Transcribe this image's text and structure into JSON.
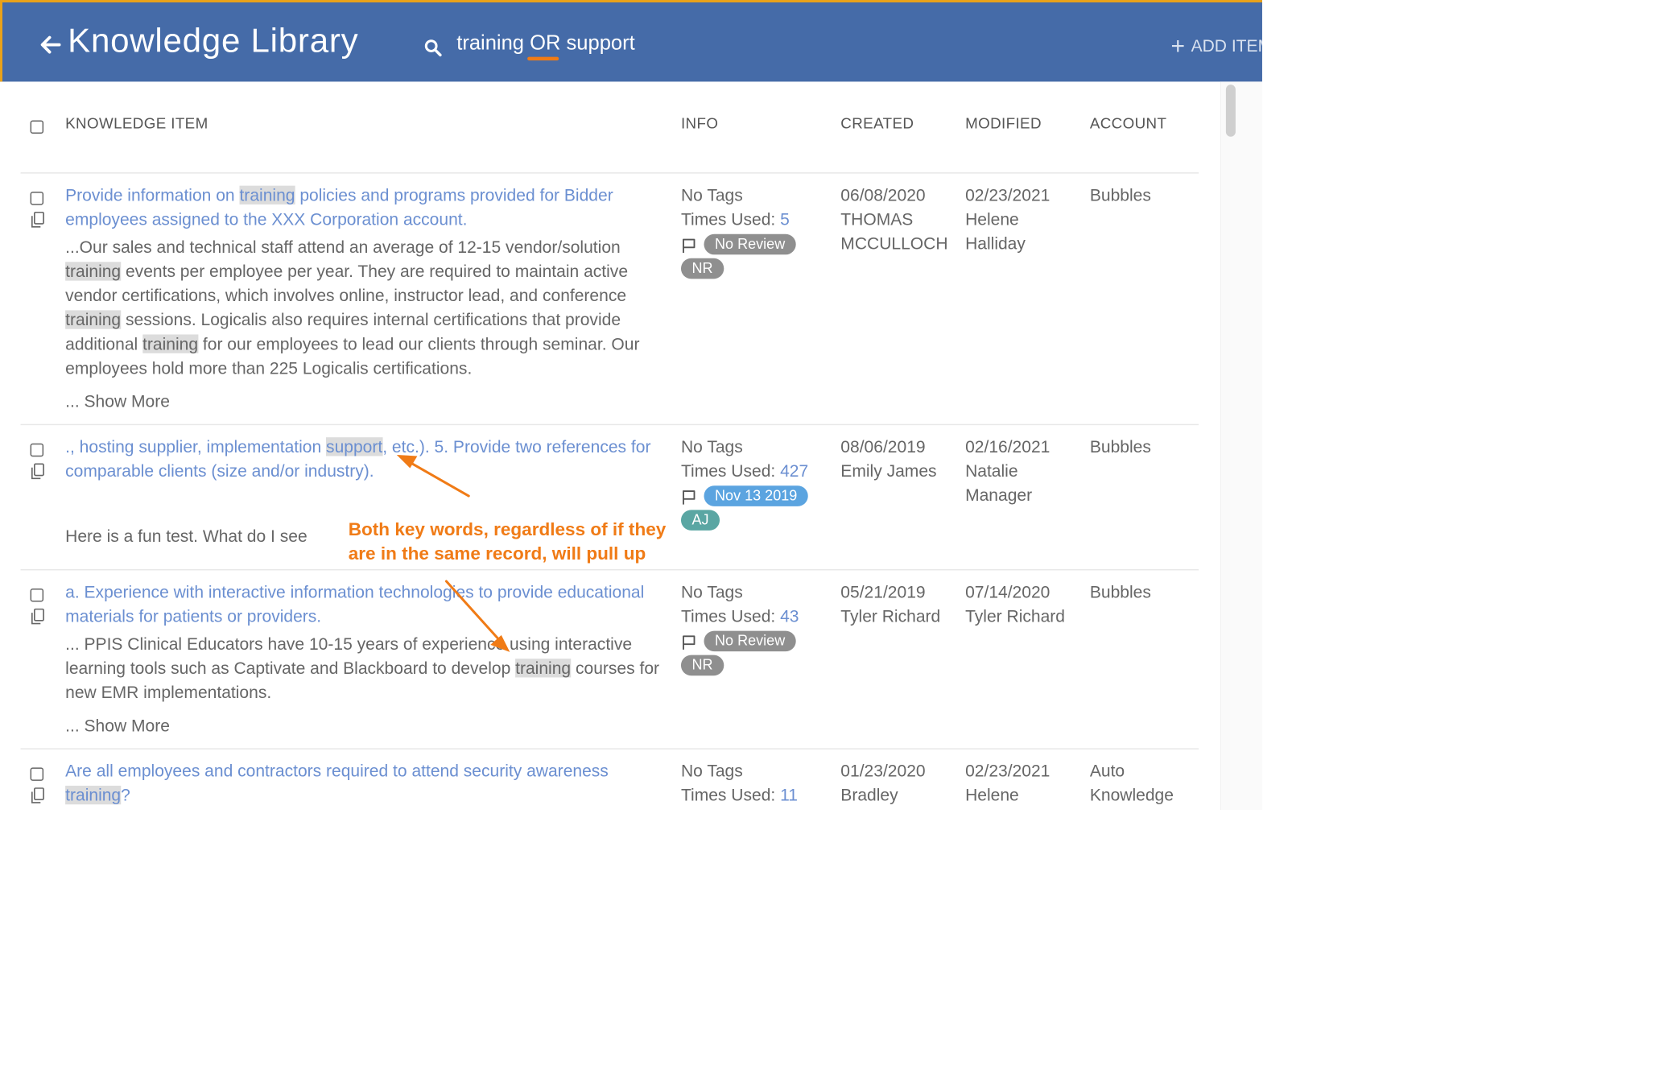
{
  "header": {
    "title": "Knowledge Library",
    "search_query": "training OR support",
    "add_item_label": "ADD ITEM"
  },
  "columns": {
    "knowledge_item": "KNOWLEDGE ITEM",
    "info": "INFO",
    "created": "CREATED",
    "modified": "MODIFIED",
    "account": "ACCOUNT"
  },
  "rows": [
    {
      "title_parts": [
        "Provide information on ",
        "training",
        " policies and programs provided for Bidder employees assigned to the XXX Corporation account."
      ],
      "snippet_parts": [
        "...Our sales and technical staff attend an average of 12-15 vendor/solution ",
        "training",
        " events per employee per year. They are required to maintain active vendor certifications, which involves online, instructor lead, and conference ",
        "training",
        " sessions. Logicalis also requires internal certifications that provide additional ",
        "training",
        " for our employees to lead our clients through seminar. Our employees hold more than 225 Logicalis certifications."
      ],
      "show_more": "... Show More",
      "tags": "No Tags",
      "times_used_label": "Times Used: ",
      "times_used": "5",
      "review_badge": "No Review",
      "initials_badge": "NR",
      "created_date": "06/08/2020",
      "created_by_1": "THOMAS",
      "created_by_2": "MCCULLOCH",
      "modified_date": "02/23/2021",
      "modified_by_1": "Helene",
      "modified_by_2": "Halliday",
      "account": "Bubbles"
    },
    {
      "title_parts": [
        "., hosting supplier, implementation ",
        "support",
        ", etc.). 5. Provide two references for comparable clients (size and/or industry)."
      ],
      "snippet": "Here is a fun test. What do I see",
      "tags": "No Tags",
      "times_used_label": "Times Used: ",
      "times_used": "427",
      "review_badge": "Nov 13 2019",
      "initials_badge": "AJ",
      "created_date": "08/06/2019",
      "created_by_1": "Emily James",
      "modified_date": "02/16/2021",
      "modified_by_1": "Natalie",
      "modified_by_2": "Manager",
      "account": "Bubbles"
    },
    {
      "title": "a. Experience with interactive information technologies to provide educational materials for patients or providers.",
      "snippet_parts": [
        "... PPIS Clinical Educators have 10-15 years of experience using interactive learning tools such as Captivate and Blackboard to develop ",
        "training",
        " courses for new EMR implementations."
      ],
      "show_more": "... Show More",
      "tags": "No Tags",
      "times_used_label": "Times Used: ",
      "times_used": "43",
      "review_badge": "No Review",
      "initials_badge": "NR",
      "created_date": "05/21/2019",
      "created_by_1": "Tyler Richard",
      "modified_date": "07/14/2020",
      "modified_by_1": "Tyler Richard",
      "account": "Bubbles"
    },
    {
      "title_parts": [
        "Are all employees and contractors required to attend security awareness ",
        "training",
        "?"
      ],
      "tags": "No Tags",
      "times_used_label": "Times Used: ",
      "times_used": "11",
      "created_date": "01/23/2020",
      "created_by_1": "Bradley",
      "modified_date": "02/23/2021",
      "modified_by_1": "Helene",
      "account_1": "Auto",
      "account_2": "Knowledge"
    }
  ],
  "annotation": {
    "line1": "Both key words, regardless of if they",
    "line2": "are in the same record, will pull up"
  },
  "colors": {
    "header_bg": "#456ba8",
    "accent_orange": "#f07b16",
    "link_blue": "#6b8fd1",
    "badge_gray": "#8f8f8f",
    "badge_blue": "#5ba4e0",
    "badge_teal": "#5aa6a3"
  },
  "icons": [
    "back-arrow-icon",
    "search-icon",
    "plus-icon",
    "checkbox-icon",
    "copy-icon",
    "flag-icon"
  ]
}
